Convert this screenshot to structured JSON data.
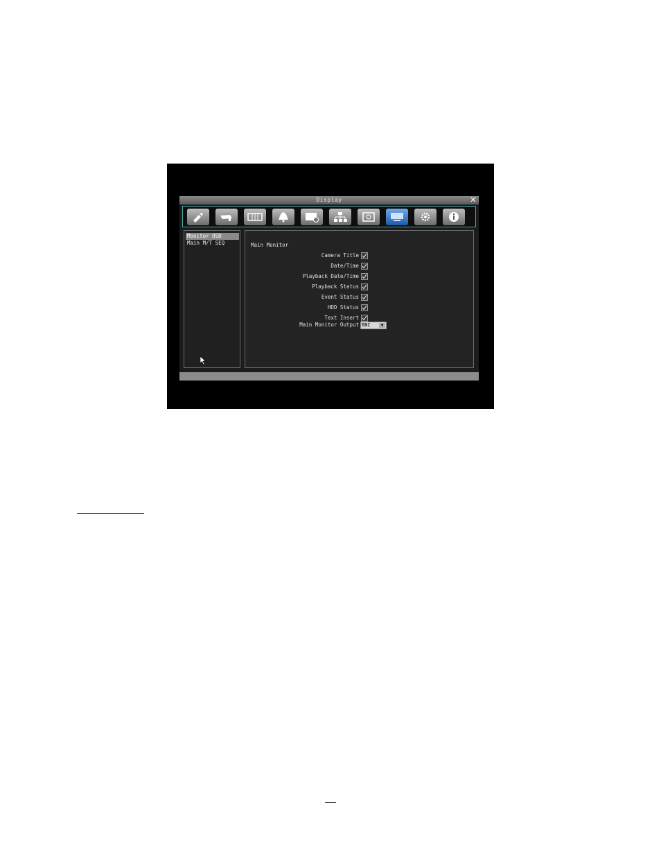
{
  "window": {
    "title": "Display",
    "close_symbol": "✕"
  },
  "toolbar": {
    "icons": [
      "quick-setup-icon",
      "camera-icon",
      "record-icon",
      "alarm-bell-icon",
      "schedule-icon",
      "network-icon",
      "backup-icon",
      "display-icon",
      "system-gear-icon",
      "info-icon"
    ],
    "active_index": 7,
    "active_color": "#2f6fc4"
  },
  "sidebar": {
    "items": [
      {
        "label": "Monitor OSD",
        "selected": true
      },
      {
        "label": "Main M/T SEQ",
        "selected": false
      }
    ]
  },
  "main": {
    "section_title": "Main Monitor",
    "options": [
      {
        "label": "Camera Title",
        "checked": true
      },
      {
        "label": "Date/Time",
        "checked": true
      },
      {
        "label": "Playback Date/Time",
        "checked": true
      },
      {
        "label": "Playback Status",
        "checked": true
      },
      {
        "label": "Event Status",
        "checked": true
      },
      {
        "label": "HDD Status",
        "checked": true
      },
      {
        "label": "Text Insert",
        "checked": true
      }
    ],
    "output": {
      "label": "Main Monitor Output",
      "value": "BNC"
    }
  }
}
